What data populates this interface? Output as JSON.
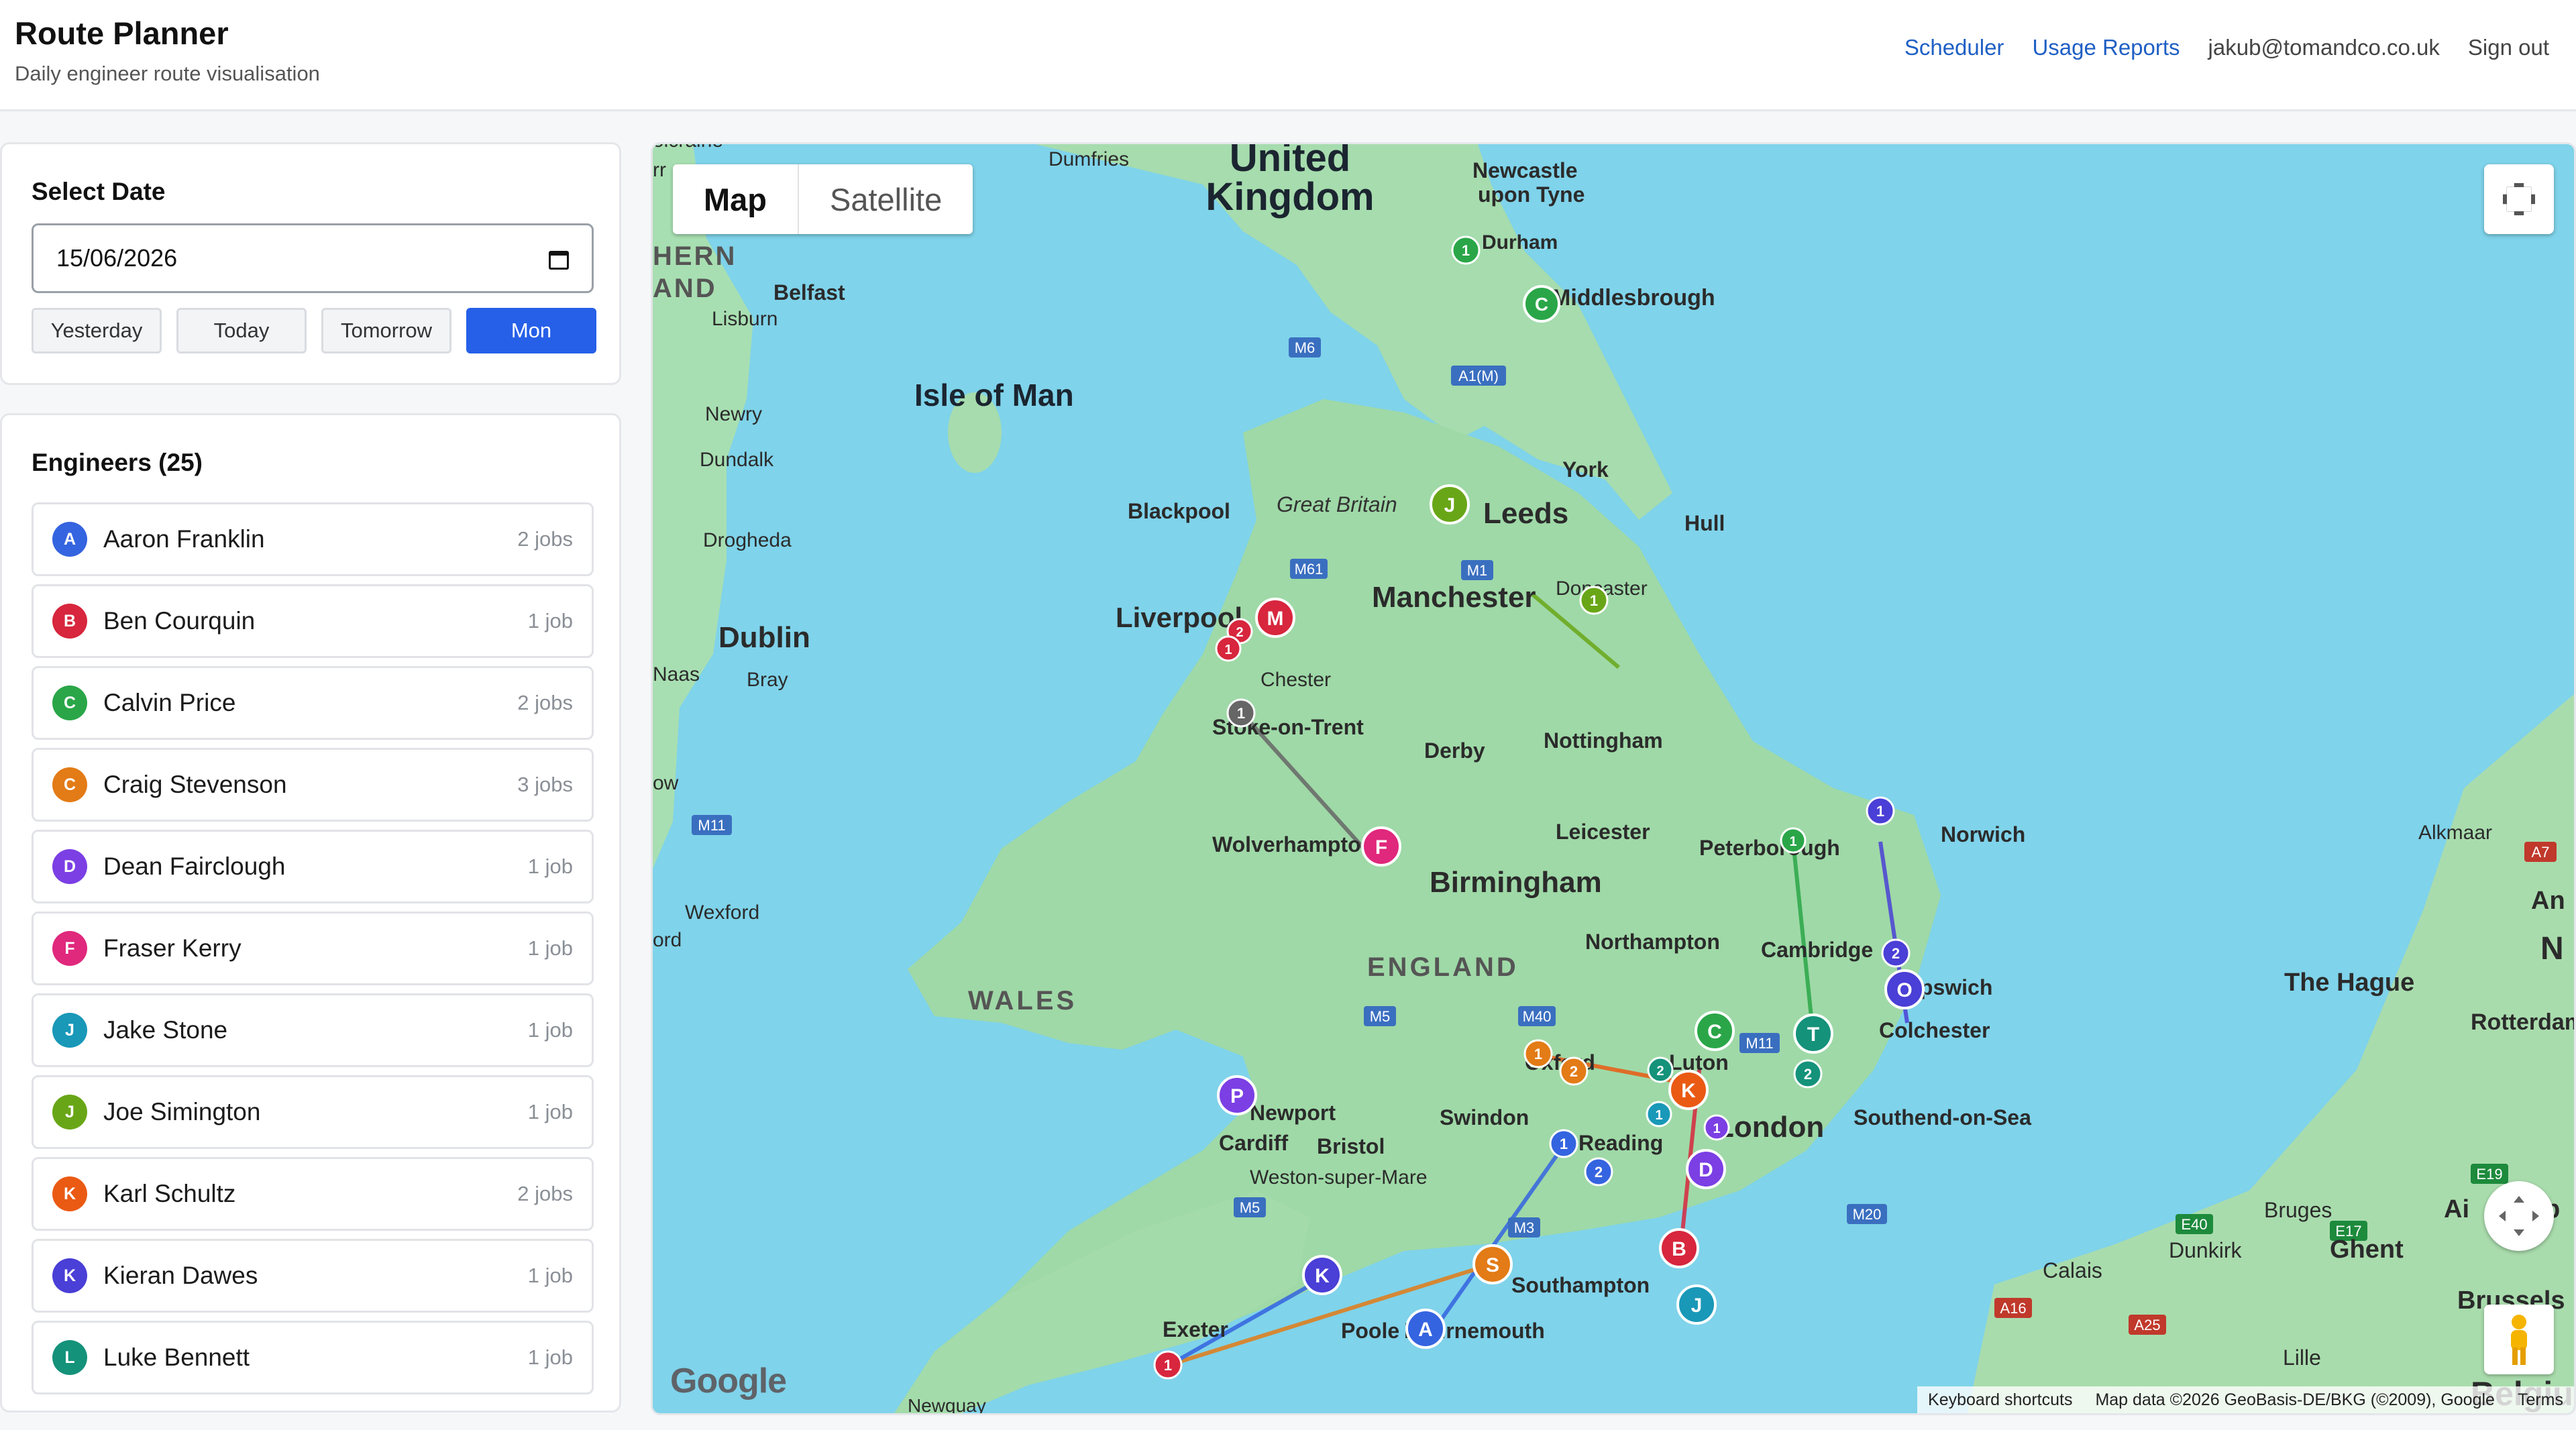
{
  "header": {
    "title": "Route Planner",
    "subtitle": "Daily engineer route visualisation",
    "nav": {
      "scheduler": "Scheduler",
      "usage_reports": "Usage Reports",
      "user_email": "jakub@tomandco.co.uk",
      "sign_out": "Sign out"
    }
  },
  "date_panel": {
    "title": "Select Date",
    "value": "15/06/2026",
    "buttons": {
      "yesterday": "Yesterday",
      "today": "Today",
      "tomorrow": "Tomorrow",
      "mon": "Mon"
    }
  },
  "engineers": {
    "title": "Engineers (25)",
    "items": [
      {
        "initial": "A",
        "name": "Aaron Franklin",
        "jobs": "2 jobs",
        "color": "#3564e0"
      },
      {
        "initial": "B",
        "name": "Ben Courquin",
        "jobs": "1 job",
        "color": "#d7263d"
      },
      {
        "initial": "C",
        "name": "Calvin Price",
        "jobs": "2 jobs",
        "color": "#2aa648"
      },
      {
        "initial": "C",
        "name": "Craig Stevenson",
        "jobs": "3 jobs",
        "color": "#e37b16"
      },
      {
        "initial": "D",
        "name": "Dean Fairclough",
        "jobs": "1 job",
        "color": "#7b3fe4"
      },
      {
        "initial": "F",
        "name": "Fraser Kerry",
        "jobs": "1 job",
        "color": "#e0287d"
      },
      {
        "initial": "J",
        "name": "Jake Stone",
        "jobs": "1 job",
        "color": "#1998b8"
      },
      {
        "initial": "J",
        "name": "Joe Simington",
        "jobs": "1 job",
        "color": "#69a617"
      },
      {
        "initial": "K",
        "name": "Karl Schultz",
        "jobs": "2 jobs",
        "color": "#ea5a13"
      },
      {
        "initial": "K",
        "name": "Kieran Dawes",
        "jobs": "1 job",
        "color": "#4a3fd6"
      },
      {
        "initial": "L",
        "name": "Luke Bennett",
        "jobs": "1 job",
        "color": "#14927a"
      }
    ]
  },
  "map": {
    "type_map": "Map",
    "type_satellite": "Satellite",
    "logo": "Google",
    "keyboard_shortcuts": "Keyboard shortcuts",
    "map_data": "Map data ©2026 GeoBasis-DE/BKG (©2009), Google",
    "terms": "Terms",
    "labels": {
      "uk1": "United",
      "uk2": "Kingdom",
      "isle_of_man": "Isle of Man",
      "wales": "WALES",
      "england": "ENGLAND",
      "great_britain": "Great Britain",
      "leeds": "Leeds",
      "manchester": "Manchester",
      "liverpool": "Liverpool",
      "birmingham": "Birmingham",
      "london": "London",
      "dublin": "Dublin",
      "newcastle1": "Newcastle",
      "newcastle2": "upon Tyne",
      "durham": "Durham",
      "middlesbrough": "Middlesbrough",
      "york": "York",
      "hull": "Hull",
      "blackpool": "Blackpool",
      "doncaster": "Doncaster",
      "chester": "Chester",
      "stoke": "Stoke-on-Trent",
      "derby": "Derby",
      "nottingham": "Nottingham",
      "leicester": "Leicester",
      "wolverhampton": "Wolverhampton",
      "peterborough": "Peterborough",
      "norwich": "Norwich",
      "northampton": "Northampton",
      "cambridge": "Cambridge",
      "ipswich": "Ipswich",
      "colchester": "Colchester",
      "oxford": "Oxford",
      "luton": "Luton",
      "newport": "Newport",
      "cardiff": "Cardiff",
      "bristol": "Bristol",
      "swindon": "Swindon",
      "reading": "Reading",
      "southend": "Southend-on-Sea",
      "weston": "Weston-super-Mare",
      "southampton": "Southampton",
      "exeter": "Exeter",
      "poole": "Poole",
      "bournemouth": "Bournemouth",
      "belfast": "Belfast",
      "lisburn": "Lisburn",
      "newry": "Newry",
      "dundalk": "Dundalk",
      "drogheda": "Drogheda",
      "naas": "Naas",
      "bray": "Bray",
      "wexford": "Wexford",
      "dumfries": "Dumfries",
      "the_hague": "The Hague",
      "rotterdam": "Rotterdam",
      "alkmaar": "Alkmaar",
      "bruges": "Bruges",
      "ghent": "Ghent",
      "dunkirk": "Dunkirk",
      "calais": "Calais",
      "lille": "Lille",
      "brussels": "Brussels",
      "belgium": "Belgium",
      "northern": "HERN",
      "ireland": "AND",
      "newquay": "Newquay",
      "ord": "ord",
      "ow": "ow",
      "rr": "rr",
      "olcraine": "olcraine",
      "an": "An",
      "n": "N",
      "ai": "Ai",
      "p": "p"
    },
    "roads": {
      "m6a": "M6",
      "m6b": "M6",
      "a1m": "A1(M)",
      "m61": "M61",
      "m1": "M1",
      "m3": "M3",
      "m11": "M11",
      "m11b": "M11",
      "m5": "M5",
      "m5b": "M5",
      "m40": "M40",
      "m3b": "M3",
      "m20": "M20",
      "a16": "A16",
      "a25": "A25",
      "e40": "E40",
      "e17": "E17",
      "e19": "E19",
      "a7": "A7"
    }
  }
}
